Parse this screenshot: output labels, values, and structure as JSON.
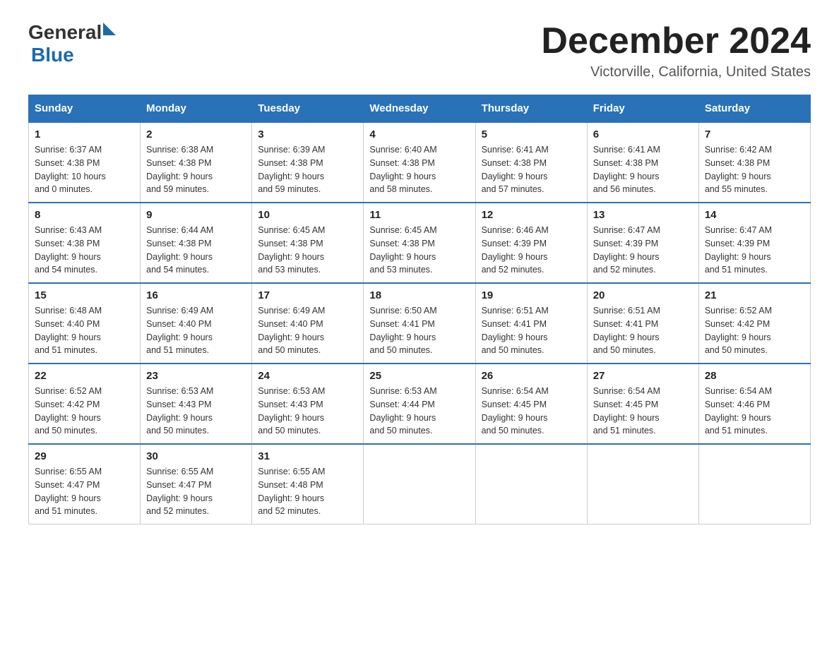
{
  "header": {
    "logo": {
      "text_general": "General",
      "triangle": "▶",
      "text_blue": "Blue"
    },
    "month_title": "December 2024",
    "location": "Victorville, California, United States"
  },
  "days_of_week": [
    "Sunday",
    "Monday",
    "Tuesday",
    "Wednesday",
    "Thursday",
    "Friday",
    "Saturday"
  ],
  "weeks": [
    [
      {
        "day": "1",
        "sunrise": "6:37 AM",
        "sunset": "4:38 PM",
        "daylight": "10 hours and 0 minutes."
      },
      {
        "day": "2",
        "sunrise": "6:38 AM",
        "sunset": "4:38 PM",
        "daylight": "9 hours and 59 minutes."
      },
      {
        "day": "3",
        "sunrise": "6:39 AM",
        "sunset": "4:38 PM",
        "daylight": "9 hours and 59 minutes."
      },
      {
        "day": "4",
        "sunrise": "6:40 AM",
        "sunset": "4:38 PM",
        "daylight": "9 hours and 58 minutes."
      },
      {
        "day": "5",
        "sunrise": "6:41 AM",
        "sunset": "4:38 PM",
        "daylight": "9 hours and 57 minutes."
      },
      {
        "day": "6",
        "sunrise": "6:41 AM",
        "sunset": "4:38 PM",
        "daylight": "9 hours and 56 minutes."
      },
      {
        "day": "7",
        "sunrise": "6:42 AM",
        "sunset": "4:38 PM",
        "daylight": "9 hours and 55 minutes."
      }
    ],
    [
      {
        "day": "8",
        "sunrise": "6:43 AM",
        "sunset": "4:38 PM",
        "daylight": "9 hours and 54 minutes."
      },
      {
        "day": "9",
        "sunrise": "6:44 AM",
        "sunset": "4:38 PM",
        "daylight": "9 hours and 54 minutes."
      },
      {
        "day": "10",
        "sunrise": "6:45 AM",
        "sunset": "4:38 PM",
        "daylight": "9 hours and 53 minutes."
      },
      {
        "day": "11",
        "sunrise": "6:45 AM",
        "sunset": "4:38 PM",
        "daylight": "9 hours and 53 minutes."
      },
      {
        "day": "12",
        "sunrise": "6:46 AM",
        "sunset": "4:39 PM",
        "daylight": "9 hours and 52 minutes."
      },
      {
        "day": "13",
        "sunrise": "6:47 AM",
        "sunset": "4:39 PM",
        "daylight": "9 hours and 52 minutes."
      },
      {
        "day": "14",
        "sunrise": "6:47 AM",
        "sunset": "4:39 PM",
        "daylight": "9 hours and 51 minutes."
      }
    ],
    [
      {
        "day": "15",
        "sunrise": "6:48 AM",
        "sunset": "4:40 PM",
        "daylight": "9 hours and 51 minutes."
      },
      {
        "day": "16",
        "sunrise": "6:49 AM",
        "sunset": "4:40 PM",
        "daylight": "9 hours and 51 minutes."
      },
      {
        "day": "17",
        "sunrise": "6:49 AM",
        "sunset": "4:40 PM",
        "daylight": "9 hours and 50 minutes."
      },
      {
        "day": "18",
        "sunrise": "6:50 AM",
        "sunset": "4:41 PM",
        "daylight": "9 hours and 50 minutes."
      },
      {
        "day": "19",
        "sunrise": "6:51 AM",
        "sunset": "4:41 PM",
        "daylight": "9 hours and 50 minutes."
      },
      {
        "day": "20",
        "sunrise": "6:51 AM",
        "sunset": "4:41 PM",
        "daylight": "9 hours and 50 minutes."
      },
      {
        "day": "21",
        "sunrise": "6:52 AM",
        "sunset": "4:42 PM",
        "daylight": "9 hours and 50 minutes."
      }
    ],
    [
      {
        "day": "22",
        "sunrise": "6:52 AM",
        "sunset": "4:42 PM",
        "daylight": "9 hours and 50 minutes."
      },
      {
        "day": "23",
        "sunrise": "6:53 AM",
        "sunset": "4:43 PM",
        "daylight": "9 hours and 50 minutes."
      },
      {
        "day": "24",
        "sunrise": "6:53 AM",
        "sunset": "4:43 PM",
        "daylight": "9 hours and 50 minutes."
      },
      {
        "day": "25",
        "sunrise": "6:53 AM",
        "sunset": "4:44 PM",
        "daylight": "9 hours and 50 minutes."
      },
      {
        "day": "26",
        "sunrise": "6:54 AM",
        "sunset": "4:45 PM",
        "daylight": "9 hours and 50 minutes."
      },
      {
        "day": "27",
        "sunrise": "6:54 AM",
        "sunset": "4:45 PM",
        "daylight": "9 hours and 51 minutes."
      },
      {
        "day": "28",
        "sunrise": "6:54 AM",
        "sunset": "4:46 PM",
        "daylight": "9 hours and 51 minutes."
      }
    ],
    [
      {
        "day": "29",
        "sunrise": "6:55 AM",
        "sunset": "4:47 PM",
        "daylight": "9 hours and 51 minutes."
      },
      {
        "day": "30",
        "sunrise": "6:55 AM",
        "sunset": "4:47 PM",
        "daylight": "9 hours and 52 minutes."
      },
      {
        "day": "31",
        "sunrise": "6:55 AM",
        "sunset": "4:48 PM",
        "daylight": "9 hours and 52 minutes."
      },
      null,
      null,
      null,
      null
    ]
  ],
  "labels": {
    "sunrise": "Sunrise:",
    "sunset": "Sunset:",
    "daylight": "Daylight:"
  }
}
